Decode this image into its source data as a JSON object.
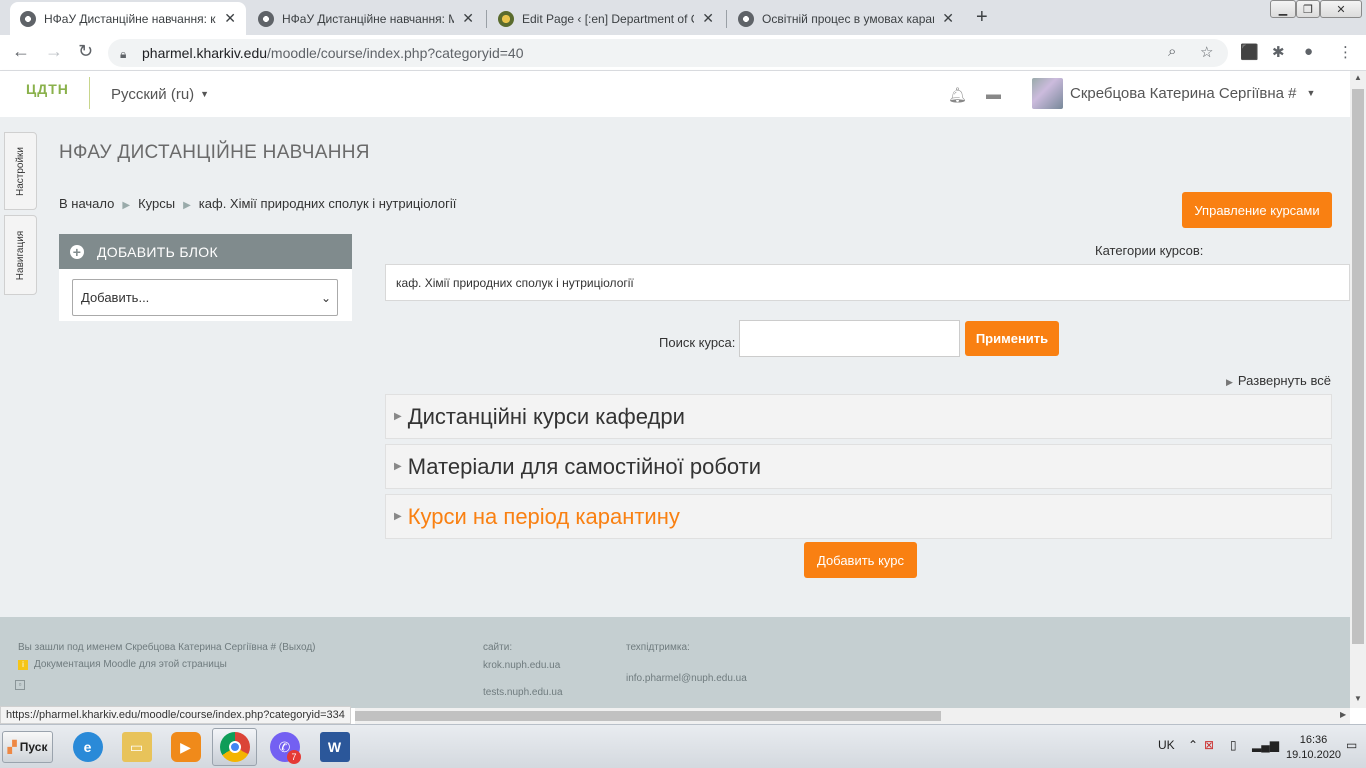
{
  "browser": {
    "tabs": [
      {
        "title": "НФаУ Дистанційне навчання: каф",
        "active": true,
        "favicon": "globe-icon"
      },
      {
        "title": "НФаУ Дистанційне навчання: Мат",
        "active": false,
        "favicon": "globe-icon"
      },
      {
        "title": "Edit Page ‹ [:en] Department of Che",
        "active": false,
        "favicon": "wordpress-icon"
      },
      {
        "title": "Освітній процес в умовах карантин",
        "active": false,
        "favicon": "globe-icon"
      }
    ],
    "url_host": "pharmel.kharkiv.edu",
    "url_path": "/moodle/course/index.php?categoryid=40"
  },
  "header": {
    "logo_text": "ЦДТН",
    "language": "Русский (ru)",
    "user_name": "Скребцова Катерина Сергіївна #"
  },
  "sidebar_tabs": {
    "settings": "Настройки",
    "navigation": "Навигация"
  },
  "page": {
    "site_title": "НФАУ ДИСТАНЦІЙНЕ НАВЧАННЯ",
    "breadcrumb": [
      "В начало",
      "Курсы",
      "каф. Хімії природних сполук і нутриціології"
    ],
    "manage_courses_button": "Управление курсами",
    "add_block": {
      "title": "ДОБАВИТЬ БЛОК",
      "select_value": "Добавить..."
    },
    "categories_label": "Категории курсов:",
    "selected_category": "каф. Хімії природних сполук і нутриціології",
    "search_label": "Поиск курса:",
    "search_value": "",
    "search_button": "Применить",
    "expand_all": "Развернуть всё",
    "categories": [
      {
        "name": "Дистанційні курси кафедри",
        "highlight": false
      },
      {
        "name": "Матеріали для самостійної роботи",
        "highlight": false
      },
      {
        "name": "Курси на період карантину",
        "highlight": true
      }
    ],
    "add_course_button": "Добавить курс"
  },
  "footer": {
    "logged_in": "Вы зашли под именем Скребцова Катерина Сергіївна # (Выход)",
    "docs_link": "Документация Moodle для этой страницы",
    "sites_label": "сайти:",
    "site1": "krok.nuph.edu.ua",
    "site2": "tests.nuph.edu.ua",
    "support_label": "техпідтримка:",
    "support_email": "info.pharmel@nuph.edu.ua"
  },
  "status_url": "https://pharmel.kharkiv.edu/moodle/course/index.php?categoryid=334",
  "taskbar": {
    "start": "Пуск",
    "viber_badge": "7",
    "lang": "UK",
    "time": "16:36",
    "date": "19.10.2020"
  },
  "colors": {
    "accent": "#f98012",
    "block_header": "#808b8d",
    "page_bg": "#eceff1",
    "footer_bg": "#c5cfd1"
  }
}
